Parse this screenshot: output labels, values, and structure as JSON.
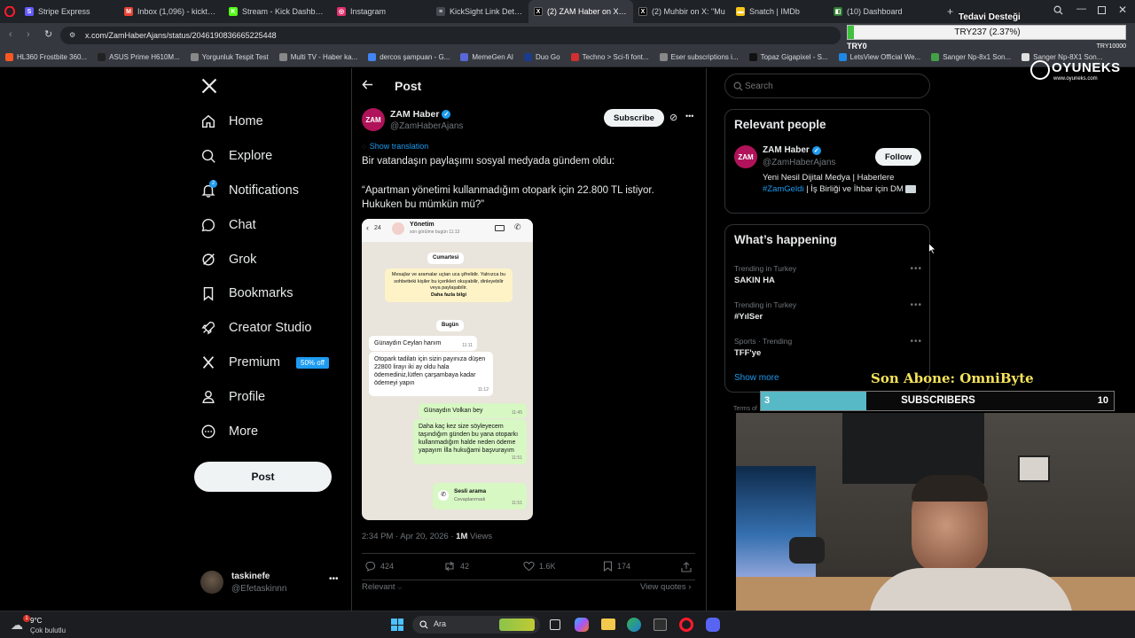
{
  "browser": {
    "tabs": [
      {
        "label": "Stripe Express",
        "color": "#635bff",
        "glyph": "S"
      },
      {
        "label": "Inbox (1,096) - kicktaskinc",
        "color": "#ea4335",
        "glyph": "M"
      },
      {
        "label": "Stream - Kick Dashboard",
        "color": "#53fc18",
        "glyph": "K"
      },
      {
        "label": "Instagram",
        "color": "#e1306c",
        "glyph": "◎"
      },
      {
        "label": "KickSight Link Detector",
        "color": "#444a50",
        "glyph": "≡"
      },
      {
        "label": "(2) ZAM Haber on X: \"Bir",
        "color": "#000000",
        "glyph": "X"
      },
      {
        "label": "(2) Muhbir on X: \"Mu",
        "color": "#000000",
        "glyph": "X"
      },
      {
        "label": "Snatch | IMDb",
        "color": "#f5c518",
        "glyph": "▬"
      },
      {
        "label": "(10) Dashboard",
        "color": "#2e7d32",
        "glyph": "◧"
      }
    ],
    "url": "x.com/ZamHaberAjans/status/2046190836665225448",
    "bookmarks": [
      {
        "label": "HL360 Frostbite 360...",
        "color": "#ff5722"
      },
      {
        "label": "ASUS Prime H610M...",
        "color": "#222222"
      },
      {
        "label": "Yorgunluk Tespit Test",
        "color": "#888888"
      },
      {
        "label": "Multi TV - Haber ka...",
        "color": "#888888"
      },
      {
        "label": "dercos şampuan - G...",
        "color": "#4285f4"
      },
      {
        "label": "MemeGen AI",
        "color": "#5a67d8"
      },
      {
        "label": "Duo Go",
        "color": "#1e3a8a"
      },
      {
        "label": "Techno > Sci-fi font...",
        "color": "#d32f2f"
      },
      {
        "label": "Eser subscriptions i...",
        "color": "#888888"
      },
      {
        "label": "Topaz Gigapixel - S...",
        "color": "#111111"
      },
      {
        "label": "LetsView Official We...",
        "color": "#1e88e5"
      },
      {
        "label": "Sanger Np-8x1 Son...",
        "color": "#43a047"
      },
      {
        "label": "Sanger Np-8X1 Son...",
        "color": "#e0e0e0"
      }
    ]
  },
  "overlay": {
    "donation_title": "Tedavi Desteği",
    "donation_amount": "TRY237 (2.37%)",
    "donation_min": "TRY0",
    "donation_max": "TRY10000",
    "donation_fraction": 0.0237,
    "brand": "OYUNEKS",
    "brand_url": "www.oyuneks.com",
    "last_sub_label": "Son Abone: OmniByte",
    "subs_current": "3",
    "subs_label": "SUBSCRIBERS",
    "subs_goal": "10",
    "subs_fraction": 0.3
  },
  "sidebar": {
    "items": [
      {
        "label": "Home",
        "icon": "home-icon"
      },
      {
        "label": "Explore",
        "icon": "search-icon"
      },
      {
        "label": "Notifications",
        "icon": "bell-icon",
        "badge": "2"
      },
      {
        "label": "Chat",
        "icon": "chat-icon"
      },
      {
        "label": "Grok",
        "icon": "grok-icon"
      },
      {
        "label": "Bookmarks",
        "icon": "bookmark-icon"
      },
      {
        "label": "Creator Studio",
        "icon": "rocket-icon"
      },
      {
        "label": "Premium",
        "icon": "x-logo-icon",
        "badge": "50% off"
      },
      {
        "label": "Profile",
        "icon": "person-icon"
      },
      {
        "label": "More",
        "icon": "more-circle-icon"
      }
    ],
    "post_button": "Post",
    "account": {
      "name": "taskinefe",
      "handle": "@Efetaskinnn"
    }
  },
  "post": {
    "header_title": "Post",
    "author": {
      "name": "ZAM Haber",
      "handle": "@ZamHaberAjans",
      "avatar_text": "ZAM"
    },
    "subscribe_label": "Subscribe",
    "show_translation": "Show translation",
    "text_line1": "Bir vatandaşın paylaşımı sosyal medyada gündem oldu:",
    "text_quote": "“Apartman yönetimi kullanmadığım otopark için 22.800 TL istiyor. Hukuken bu mümkün mü?”",
    "meta_time": "2:34 PM · Apr 20, 2026 ·",
    "meta_views": "1M",
    "meta_views_label": "Views",
    "stats": {
      "replies": "424",
      "reposts": "42",
      "likes": "1.6K",
      "bookmarks": "174"
    },
    "relevant_label": "Relevant",
    "view_quotes": "View quotes",
    "chat": {
      "back_count": "24",
      "contact": "Yönetim",
      "last_seen": "son görülme bugün 11:13",
      "day1": "Cumartesi",
      "security": "Mesajlar ve aramalar uçtan uca şifrelidir. Yalnızca bu sohbetteki kişiler bu içerikleri okuyabilir, dinleyebilir veya paylaşabilir.",
      "security_link": "Daha fazla bilgi",
      "day2": "Bugün",
      "m1": "Günaydın Ceylan hanım",
      "m1_time": "11:11",
      "m2": "Otopark tadilatı için sizin payınıza düşen 22800 lirayı iki ay oldu hala ödemediniz,lütfen çarşambaya kadar ödemeyi yapın",
      "m2_time": "11:12",
      "m3": "Günaydın Volkan bey",
      "m3_time": "11:45",
      "m4": "Daha kaç kez size söyleyecem taşındığım günden bu yana otoparkı kullanmadığım halde neden ödeme yapayım İlla hukuğami başvurayım",
      "m4_time": "11:51",
      "call_title": "Sesli arama",
      "call_sub": "Cevaplanmadı",
      "call_time": "11:51"
    }
  },
  "right": {
    "search_placeholder": "Search",
    "relevant_people_title": "Relevant people",
    "person": {
      "name": "ZAM Haber",
      "handle": "@ZamHaberAjans",
      "follow": "Follow",
      "bio_1": "Yeni Nesil Dijital Medya | Haberlere",
      "bio_tag": "#ZamGeldi",
      "bio_2": " | İş Birliği ve İhbar için DM"
    },
    "happening_title": "What’s happening",
    "trends": [
      {
        "context": "Trending in Turkey",
        "title": "SAKIN HA"
      },
      {
        "context": "Trending in Turkey",
        "title": "#YılSer"
      },
      {
        "context": "Sports · Trending",
        "title": "TFF'ye"
      }
    ],
    "show_more": "Show more",
    "terms": "Terms of"
  },
  "taskbar": {
    "weather_temp": "9°C",
    "weather_desc": "Çok bulutlu",
    "search_label": "Ara"
  }
}
